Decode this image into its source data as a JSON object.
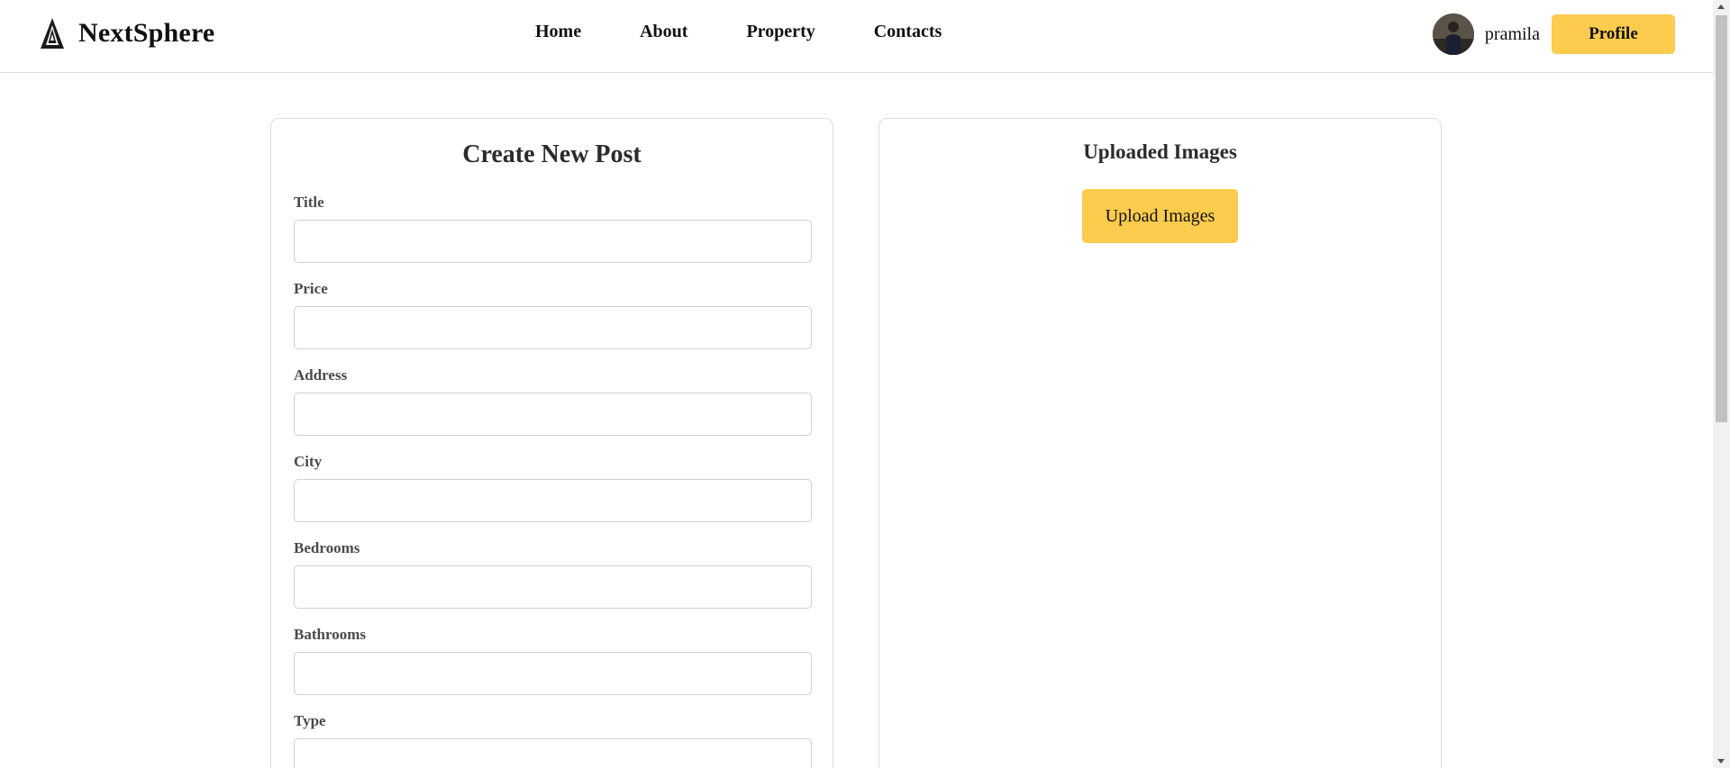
{
  "header": {
    "brand_name": "NextSphere",
    "nav": [
      "Home",
      "About",
      "Property",
      "Contacts"
    ],
    "user": {
      "name": "pramila"
    },
    "profile_button": "Profile"
  },
  "form": {
    "title": "Create New Post",
    "fields": [
      {
        "label": "Title",
        "value": ""
      },
      {
        "label": "Price",
        "value": ""
      },
      {
        "label": "Address",
        "value": ""
      },
      {
        "label": "City",
        "value": ""
      },
      {
        "label": "Bedrooms",
        "value": ""
      },
      {
        "label": "Bathrooms",
        "value": ""
      },
      {
        "label": "Type",
        "value": ""
      }
    ]
  },
  "images": {
    "title": "Uploaded Images",
    "upload_button": "Upload Images"
  },
  "colors": {
    "accent": "#fdcb4d",
    "border": "#dedede",
    "text": "#222222"
  },
  "icons": {
    "logo": "triangle-logo-icon",
    "avatar": "user-avatar"
  }
}
